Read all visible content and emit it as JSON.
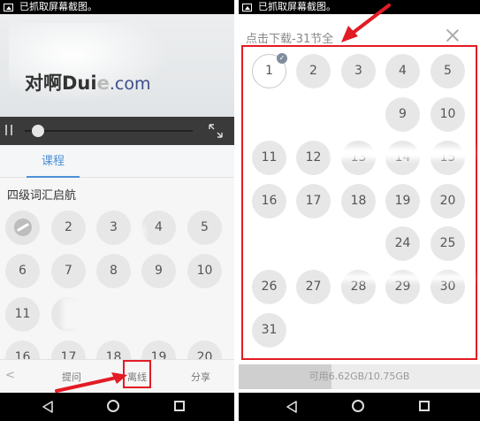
{
  "status_text": "已抓取屏幕截图。",
  "left": {
    "logo": {
      "text": "对啊Dui",
      "suffix": "com"
    },
    "tab_course": "课程",
    "section_title": "四级词汇启航",
    "lessons": [
      "2",
      "3",
      "4",
      "5",
      "6",
      "7",
      "8",
      "9",
      "10",
      "11",
      "16",
      "17",
      "18",
      "19",
      "20"
    ],
    "bottom": {
      "ask": "提问",
      "offline": "离线",
      "share": "分享"
    },
    "seek_fraction": 0.08
  },
  "right": {
    "title": "点击下载-31节全",
    "lessons": [
      "1",
      "2",
      "3",
      "4",
      "5",
      "9",
      "10",
      "11",
      "12",
      "13",
      "14",
      "15",
      "16",
      "17",
      "18",
      "19",
      "20",
      "24",
      "25",
      "26",
      "27",
      "28",
      "29",
      "30",
      "31"
    ],
    "storage_text": "可用6.62GB/10.75GB",
    "storage_used_fraction": 0.384
  },
  "colors": {
    "accent": "#4d90d6",
    "highlight": "#e21b24"
  },
  "icons": {
    "pause": "pause-icon",
    "fullscreen": "fullscreen-icon",
    "close": "close-icon",
    "check": "check-badge-icon"
  }
}
